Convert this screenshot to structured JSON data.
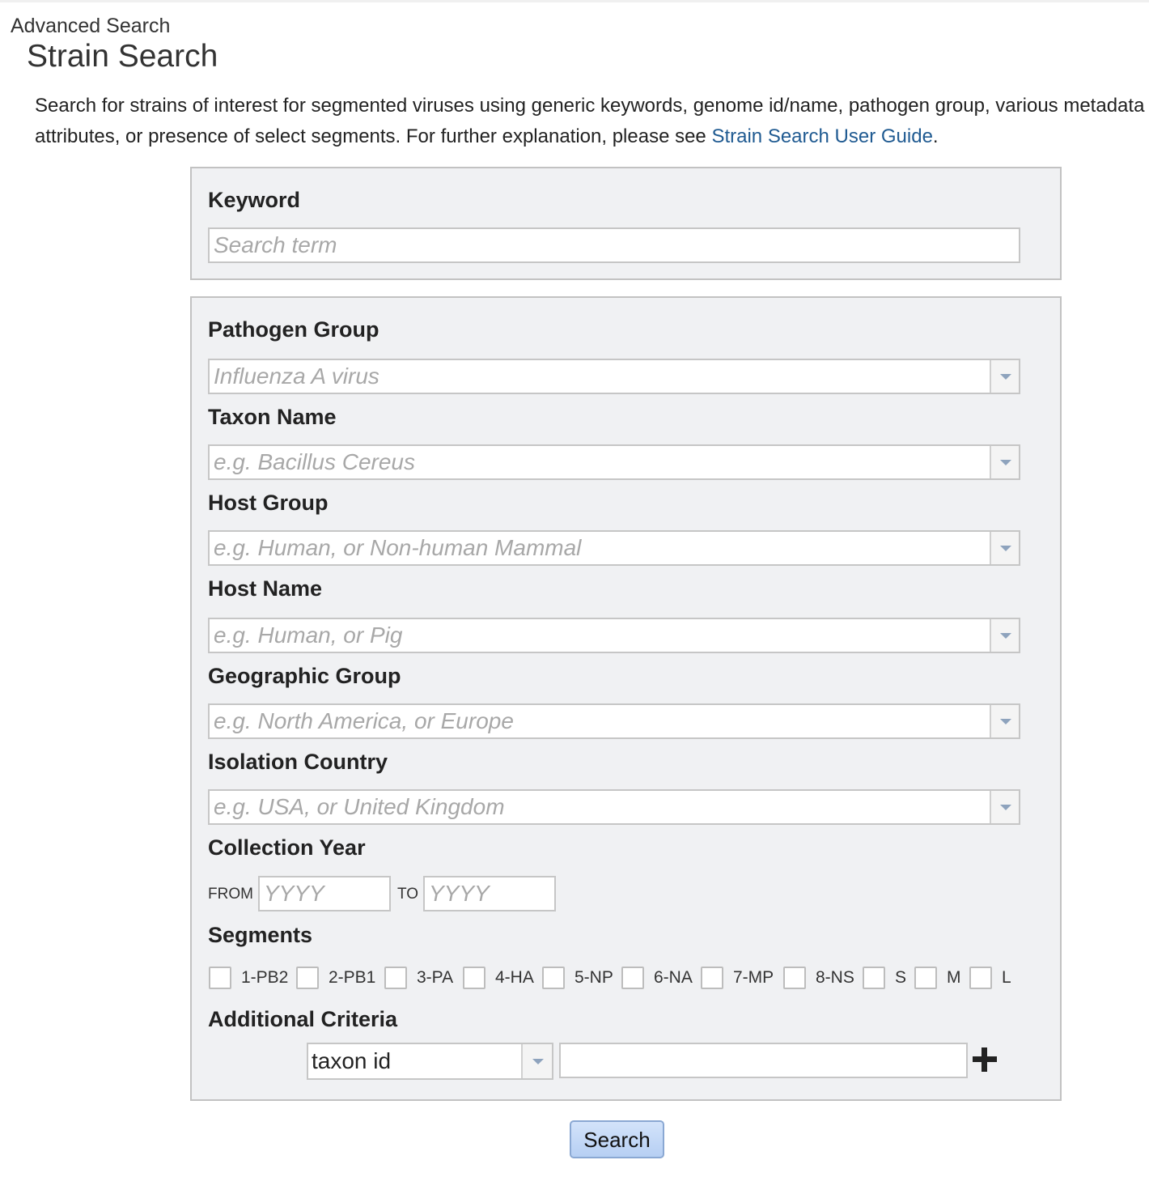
{
  "breadcrumb": "Advanced Search",
  "title": "Strain Search",
  "intro": {
    "text": "Search for strains of interest for segmented viruses using generic keywords, genome id/name, pathogen group, various metadata attributes, or presence of select segments. For further explanation, please see ",
    "link": "Strain Search User Guide",
    "end": "."
  },
  "keyword": {
    "label": "Keyword",
    "placeholder": "Search term"
  },
  "fields": {
    "pathogen_group": {
      "label": "Pathogen Group",
      "placeholder": "Influenza A virus"
    },
    "taxon_name": {
      "label": "Taxon Name",
      "placeholder": "e.g. Bacillus Cereus"
    },
    "host_group": {
      "label": "Host Group",
      "placeholder": "e.g. Human, or Non-human Mammal"
    },
    "host_name": {
      "label": "Host Name",
      "placeholder": "e.g. Human, or Pig"
    },
    "geographic_group": {
      "label": "Geographic Group",
      "placeholder": "e.g. North America, or Europe"
    },
    "isolation_country": {
      "label": "Isolation Country",
      "placeholder": "e.g. USA, or United Kingdom"
    }
  },
  "collection_year": {
    "label": "Collection Year",
    "from": "FROM",
    "to": "TO",
    "placeholder": "YYYY"
  },
  "segments": {
    "label": "Segments",
    "items": [
      "1-PB2",
      "2-PB1",
      "3-PA",
      "4-HA",
      "5-NP",
      "6-NA",
      "7-MP",
      "8-NS",
      "S",
      "M",
      "L"
    ]
  },
  "additional": {
    "label": "Additional Criteria",
    "selected": "taxon id",
    "value": ""
  },
  "search_button": "Search",
  "colors": {
    "link": "#1f5a91",
    "panel_bg": "#f0f1f3",
    "button": "#c6daf6"
  },
  "icons": {
    "dropdown": "chevron-down-icon",
    "add": "plus-icon"
  }
}
